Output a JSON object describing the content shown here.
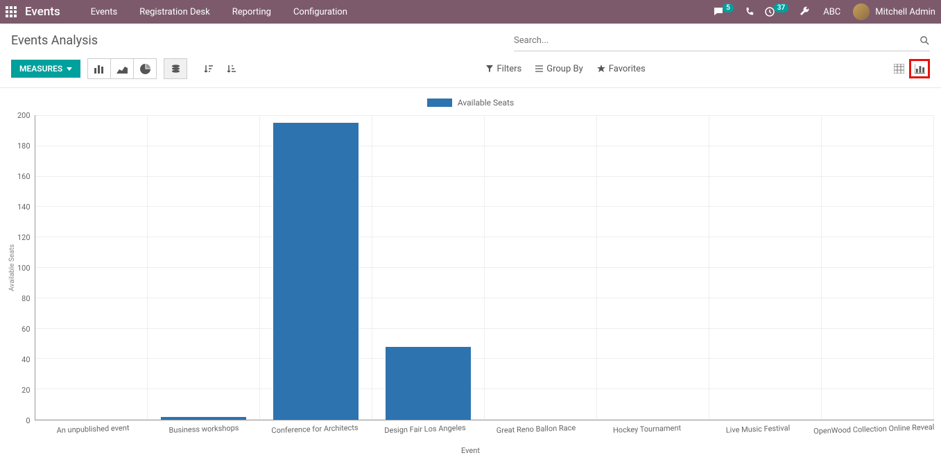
{
  "navbar": {
    "brand": "Events",
    "links": [
      "Events",
      "Registration Desk",
      "Reporting",
      "Configuration"
    ],
    "messages_badge": "5",
    "activities_badge": "37",
    "company": "ABC",
    "user": "Mitchell Admin"
  },
  "page_title": "Events Analysis",
  "search": {
    "placeholder": "Search..."
  },
  "toolbar": {
    "measures_label": "MEASURES",
    "filters_label": "Filters",
    "groupby_label": "Group By",
    "favorites_label": "Favorites"
  },
  "chart_data": {
    "type": "bar",
    "title": "",
    "legend": [
      "Available Seats"
    ],
    "xlabel": "Event",
    "ylabel": "Available Seats",
    "categories": [
      "An unpublished event",
      "Business workshops",
      "Conference for Architects",
      "Design Fair Los Angeles",
      "Great Reno Ballon Race",
      "Hockey Tournament",
      "Live Music Festival",
      "OpenWood Collection Online Reveal"
    ],
    "values": [
      0,
      2,
      195,
      48,
      0,
      0,
      0,
      0
    ],
    "ylim": [
      0,
      200
    ],
    "yticks": [
      200,
      180,
      160,
      140,
      120,
      100,
      80,
      60,
      40,
      20,
      0
    ]
  },
  "colors": {
    "bar": "#2d73b0",
    "accent": "#00a09d",
    "highlight": "#e8120b"
  }
}
